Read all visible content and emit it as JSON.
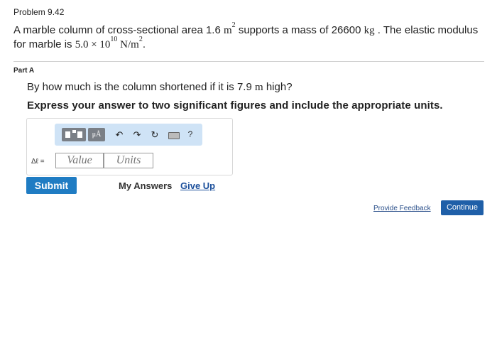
{
  "problem": {
    "label": "Problem 9.42",
    "text_intro": "A marble column of cross-sectional area ",
    "area_value": "1.6",
    "area_unit": "m",
    "area_unit_exp": "2",
    "text_mid": " supports a mass of ",
    "mass_value": "26600",
    "mass_unit": "kg",
    "text_modulus": " . The elastic modulus for marble is ",
    "modulus_mantissa": "5.0",
    "modulus_times": "×",
    "modulus_base": "10",
    "modulus_exp": "10",
    "modulus_unit": "N/m",
    "modulus_unit_exp": "2",
    "text_end": "."
  },
  "part": {
    "label": "Part A",
    "question_intro": "By how much is the column shortened if it is ",
    "height_value": "7.9",
    "height_unit": "m",
    "question_end": " high?",
    "instruction": "Express your answer to two significant figures and include the appropriate units."
  },
  "answer": {
    "variable_label": "Δℓ =",
    "value_placeholder": "Value",
    "units_placeholder": "Units",
    "toolbar": {
      "mu_label": "μÅ",
      "undo_icon": "↶",
      "redo_icon": "↷",
      "reset_icon": "↻",
      "help_label": "?"
    }
  },
  "actions": {
    "submit_label": "Submit",
    "my_answers_label": "My Answers",
    "give_up_label": "Give Up",
    "feedback_label": "Provide Feedback",
    "continue_label": "Continue"
  },
  "colors": {
    "accent": "#1f7cc3",
    "continue": "#1f5fa8",
    "toolbar_bg": "#cfe3f6",
    "link": "#1b4f9b"
  }
}
